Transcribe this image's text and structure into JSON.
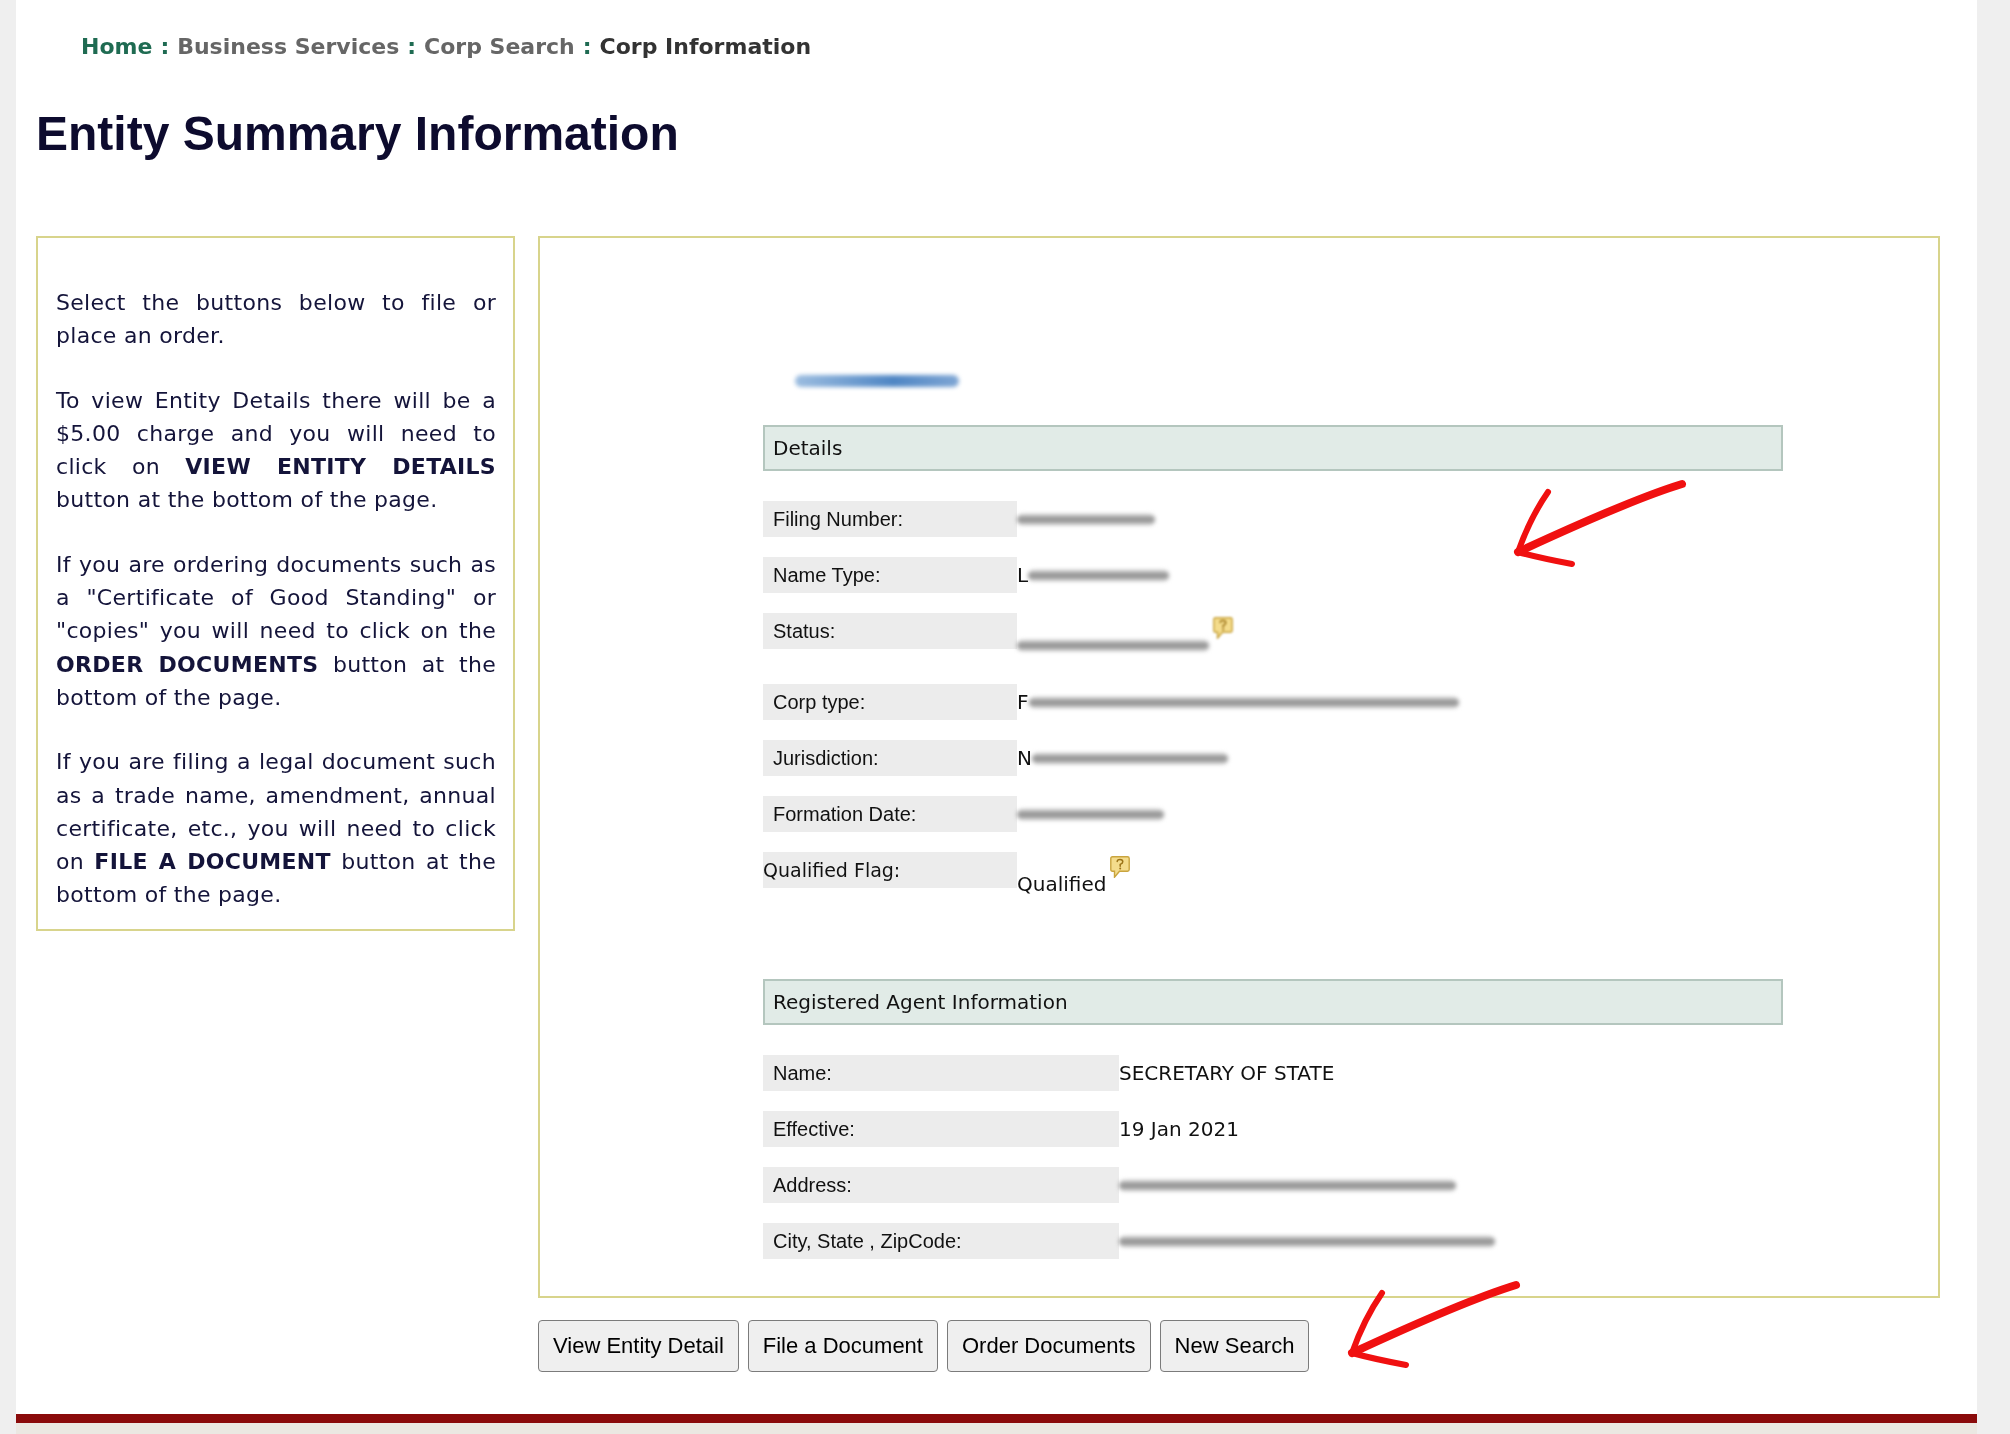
{
  "breadcrumb": [
    {
      "kind": "link",
      "label": "Home",
      "color": "#1f6b52"
    },
    {
      "kind": "separator",
      "label": ":"
    },
    {
      "kind": "link",
      "label": "Business Services",
      "color": "#666666"
    },
    {
      "kind": "separator",
      "label": ":"
    },
    {
      "kind": "link",
      "label": "Corp Search",
      "color": "#666666"
    },
    {
      "kind": "separator",
      "label": ":"
    },
    {
      "kind": "current",
      "label": "Corp Information",
      "color": "#333333"
    }
  ],
  "title": "Entity Summary Information",
  "instructions": [
    "Select the buttons below to file or place an order.",
    "To view Entity Details there will be a $5.00 charge and you will need to click on **VIEW ENTITY DETAILS** button at the bottom of the page.",
    "If you are ordering documents such as a \"Certificate of Good Standing\" or \"copies\" you will need to click on the **ORDER DOCUMENTS** button at the bottom of the page.",
    "If you are filing a legal document such as a trade name, amendment, annual certificate, etc., you will need to click on **FILE A DOCUMENT** button at the bottom of the page."
  ],
  "entity_name": {
    "redacted": true
  },
  "sections": [
    {
      "title": "Details",
      "rows": [
        {
          "kind": "field",
          "label": "Filing Number:",
          "value": {
            "redacted": true
          },
          "note_icon": false
        },
        {
          "kind": "field",
          "label": "Name Type:",
          "value": {
            "text": "L",
            "redacted": true
          },
          "note_icon": false
        },
        {
          "kind": "field",
          "label": "Status:",
          "value": {
            "redacted": true
          },
          "note_icon": true
        },
        {
          "kind": "field",
          "label": "Corp type:",
          "value": {
            "text": "F",
            "redacted": true
          },
          "note_icon": false
        },
        {
          "kind": "field",
          "label": "Jurisdiction:",
          "value": {
            "text": "N",
            "redacted": true
          },
          "note_icon": false
        },
        {
          "kind": "field",
          "label": "Formation Date:",
          "value": {
            "redacted": true
          },
          "note_icon": false
        },
        {
          "kind": "flag",
          "label": "Qualified Flag:",
          "value": {
            "text": "Qualified",
            "redacted": false
          },
          "note_icon": true
        }
      ]
    },
    {
      "title": "Registered Agent Information",
      "rows": [
        {
          "kind": "field",
          "label": "Name:",
          "value": {
            "text": "SECRETARY OF STATE",
            "redacted": false
          },
          "note_icon": false
        },
        {
          "kind": "field",
          "label": "Effective:",
          "value": {
            "text": "19 Jan 2021",
            "redacted": false
          },
          "note_icon": false
        },
        {
          "kind": "field",
          "label": "Address:",
          "value": {
            "redacted": true
          },
          "note_icon": false
        },
        {
          "kind": "field",
          "label": "City, State , ZipCode:",
          "value": {
            "redacted": true
          },
          "note_icon": false
        }
      ]
    }
  ],
  "buttons": [
    "View Entity Detail",
    "File a Document",
    "Order Documents",
    "New Search"
  ]
}
